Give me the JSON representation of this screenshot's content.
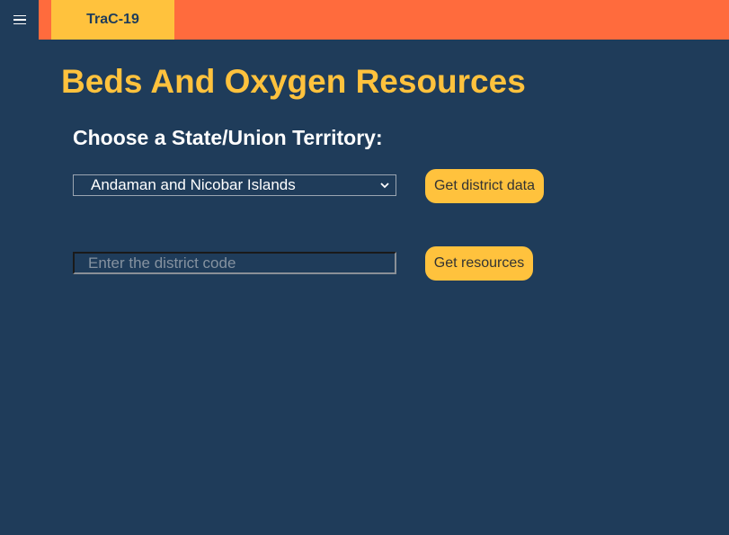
{
  "header": {
    "brand": "TraC-19",
    "menu_icon": "hamburger-menu-icon",
    "colors": {
      "bar": "#ff6b3d",
      "brand_bg": "#ffc23d",
      "page_bg": "#1f3c5a"
    }
  },
  "main": {
    "title": "Beds And Oxygen Resources",
    "state_label": "Choose a State/Union Territory:",
    "state_select": {
      "selected": "Andaman and Nicobar Islands"
    },
    "district_button": "Get district data",
    "district_input": {
      "value": "",
      "placeholder": "Enter the district code"
    },
    "resources_button": "Get resources"
  }
}
